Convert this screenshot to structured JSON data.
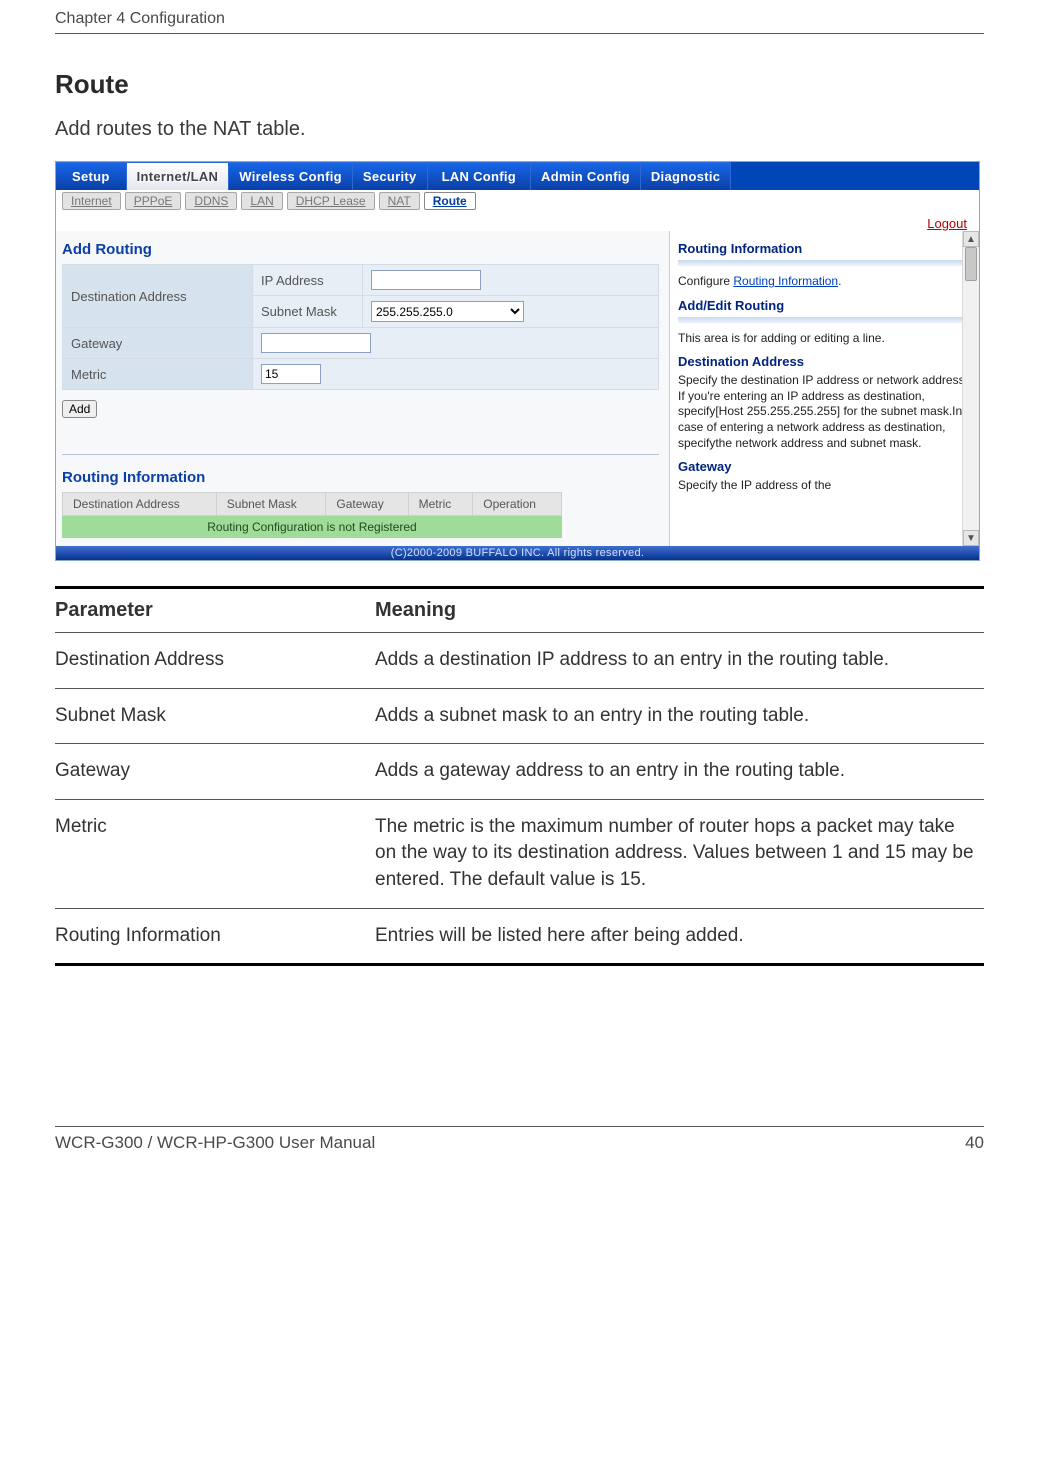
{
  "header": {
    "chapter": "Chapter 4  Configuration"
  },
  "title": "Route",
  "intro": "Add routes to the NAT table.",
  "ui": {
    "tabs": [
      "Setup",
      "Internet/LAN",
      "Wireless Config",
      "Security",
      "LAN Config",
      "Admin Config",
      "Diagnostic"
    ],
    "subtabs": [
      "Internet",
      "PPPoE",
      "DDNS",
      "LAN",
      "DHCP Lease",
      "NAT",
      "Route"
    ],
    "logout": "Logout",
    "add_routing_heading": "Add Routing",
    "form": {
      "dest_label": "Destination Address",
      "ip_label": "IP Address",
      "subnet_label": "Subnet Mask",
      "subnet_value": "255.255.255.0",
      "gateway_label": "Gateway",
      "metric_label": "Metric",
      "metric_value": "15",
      "add_btn": "Add"
    },
    "routing_info_heading": "Routing Information",
    "routing_columns": [
      "Destination Address",
      "Subnet Mask",
      "Gateway",
      "Metric",
      "Operation"
    ],
    "routing_empty": "Routing Configuration is not Registered",
    "help": {
      "h_info": "Routing Information",
      "p_info_pre": "Configure ",
      "p_info_link": "Routing Information",
      "p_info_post": ".",
      "h_addedit": "Add/Edit Routing",
      "p_addedit": "This area is for adding or editing a line.",
      "h_dest": "Destination Address",
      "p_dest": "Specify the destination IP address or network address.\nIf you're entering an IP address as destination, specify[Host 255.255.255.255] for the subnet mask.In case of entering a network address as destination, specifythe network address and subnet mask.",
      "h_gw": "Gateway",
      "p_gw": "Specify the IP address of the"
    },
    "copyright": "(C)2000-2009 BUFFALO INC. All rights reserved."
  },
  "param_table": {
    "headers": [
      "Parameter",
      "Meaning"
    ],
    "rows": [
      {
        "p": "Destination Address",
        "m": "Adds a destination IP address to an entry in the routing table."
      },
      {
        "p": "Subnet Mask",
        "m": "Adds a subnet mask to an entry in the routing table."
      },
      {
        "p": "Gateway",
        "m": "Adds a gateway address to an entry in the routing table."
      },
      {
        "p": "Metric",
        "m": "The metric is the maximum number of router hops a packet may take on the way to its destination address. Values between 1 and 15 may be entered. The default value is 15."
      },
      {
        "p": "Routing Information",
        "m": "Entries will be listed here after being added."
      }
    ]
  },
  "footer": {
    "manual": "WCR-G300 / WCR-HP-G300 User Manual",
    "page": "40"
  }
}
